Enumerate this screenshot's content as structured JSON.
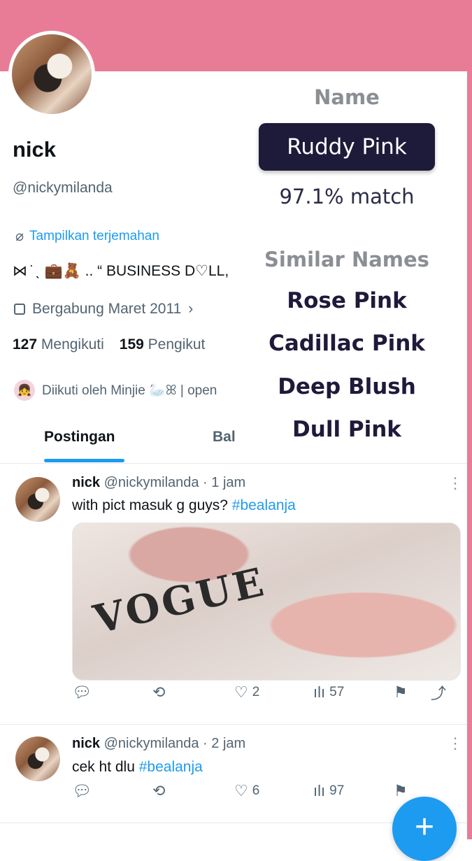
{
  "profile": {
    "display_name": "nick",
    "handle": "@nickymilanda",
    "translate_label": "Tampilkan terjemahan",
    "bio": "⋈ ̇ ˎ 💼🧸 .. “ BUSINESS D♡LL,",
    "joined": "Bergabung Maret 2011",
    "following_count": "127",
    "following_label": "Mengikuti",
    "followers_count": "159",
    "followers_label": "Pengikut",
    "followed_by": "Diikuti oleh Minjie 🦢ꕤ | open"
  },
  "tabs": [
    {
      "label": "Postingan",
      "active": true
    },
    {
      "label": "Bal",
      "active": false
    }
  ],
  "color_overlay": {
    "name_label": "Name",
    "color_name": "Ruddy Pink",
    "match": "97.1% match",
    "similar_label": "Similar Names",
    "similar": [
      "Rose Pink",
      "Cadillac Pink",
      "Deep Blush",
      "Dull Pink"
    ]
  },
  "posts": [
    {
      "name": "nick",
      "meta": "@nickymilanda · 1 jam",
      "text": "with pict masuk g guys? ",
      "hashtag": "#bealanja",
      "media_text": "VOGUE",
      "likes": "2",
      "views": "57"
    },
    {
      "name": "nick",
      "meta": "@nickymilanda · 2 jam",
      "text": "cek ht dlu ",
      "hashtag": "#bealanja",
      "likes": "6",
      "views": "97"
    }
  ],
  "fab_label": "+",
  "icons": [
    "translate-icon",
    "calendar-icon",
    "chevron-right-icon",
    "reply-icon",
    "retweet-icon",
    "like-icon",
    "views-icon",
    "bookmark-icon",
    "share-icon",
    "more-icon",
    "compose-icon"
  ],
  "colors": {
    "banner": "#e87c96",
    "accent": "#1d9bf0",
    "overlay_box": "#1e1a3a"
  }
}
